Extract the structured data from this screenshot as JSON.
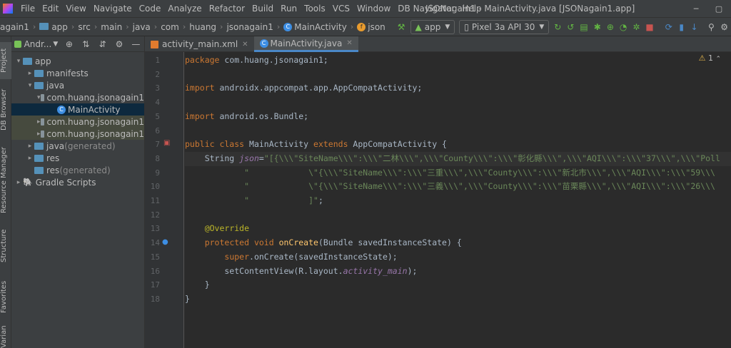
{
  "menubar": {
    "items": [
      "File",
      "Edit",
      "View",
      "Navigate",
      "Code",
      "Analyze",
      "Refactor",
      "Build",
      "Run",
      "Tools",
      "VCS",
      "Window",
      "DB Navigator",
      "Help"
    ],
    "title": "JSONagain1 - MainActivity.java [JSONagain1.app]",
    "minimize": "─",
    "restore": "▢"
  },
  "navbar": {
    "breadcrumbs": [
      "again1",
      "app",
      "src",
      "main",
      "java",
      "com",
      "huang",
      "jsonagain1",
      "MainActivity",
      "json"
    ],
    "run_config": "app",
    "device": "Pixel 3a API 30"
  },
  "leftstrip": {
    "tabs": [
      "Project",
      "DB Browser",
      "Resource Manager",
      "Structure",
      "Favorites",
      "Variants"
    ]
  },
  "project": {
    "view_name": "Andr...",
    "tree": [
      {
        "label": "app",
        "arrow": "▾",
        "indent": 0,
        "kind": "blue"
      },
      {
        "label": "manifests",
        "arrow": "▸",
        "indent": 1,
        "kind": "blue"
      },
      {
        "label": "java",
        "arrow": "▾",
        "indent": 1,
        "kind": "blue"
      },
      {
        "label": "com.huang.jsonagain1",
        "arrow": "▾",
        "indent": 2,
        "kind": "pkg"
      },
      {
        "label": "MainActivity",
        "arrow": "",
        "indent": 3,
        "kind": "class",
        "selected": true
      },
      {
        "label": "com.huang.jsonagain1",
        "arrow": "▸",
        "indent": 2,
        "kind": "pkg",
        "muted": true
      },
      {
        "label": "com.huang.jsonagain1",
        "arrow": "▸",
        "indent": 2,
        "kind": "pkg",
        "muted": true
      },
      {
        "label": "java",
        "suffix": " (generated)",
        "arrow": "▸",
        "indent": 1,
        "kind": "blue"
      },
      {
        "label": "res",
        "arrow": "▸",
        "indent": 1,
        "kind": "blue"
      },
      {
        "label": "res",
        "suffix": " (generated)",
        "arrow": "",
        "indent": 1,
        "kind": "blue"
      },
      {
        "label": "Gradle Scripts",
        "arrow": "▸",
        "indent": 0,
        "kind": "gradle"
      }
    ]
  },
  "editor": {
    "tabs": [
      {
        "label": "activity_main.xml",
        "active": false
      },
      {
        "label": "MainActivity.java",
        "active": true
      }
    ],
    "warning_count": "1",
    "lines": [
      {
        "n": "1",
        "html": "<span class=\"kw\">package </span>com.huang.jsonagain1;"
      },
      {
        "n": "2",
        "html": ""
      },
      {
        "n": "3",
        "html": "<span class=\"kw\">import </span>androidx.appcompat.app.AppCompatActivity;"
      },
      {
        "n": "4",
        "html": ""
      },
      {
        "n": "5",
        "html": "<span class=\"kw\">import </span>android.os.Bundle;"
      },
      {
        "n": "6",
        "html": ""
      },
      {
        "n": "7",
        "html": "<span class=\"kw\">public class </span>MainActivity <span class=\"kw\">extends </span>AppCompatActivity {"
      },
      {
        "n": "8",
        "html": "    String <span class=\"it\">json</span>=<span class=\"str\">\"[{\\\\\\\"SiteName\\\\\\\":\\\\\\\"二林\\\\\\\",\\\\\\\"County\\\\\\\":\\\\\\\"彰化縣\\\\\\\",\\\\\\\"AQI\\\\\\\":\\\\\\\"37\\\\\\\",\\\\\\\"Poll</span>",
        "cur": true
      },
      {
        "n": "9",
        "html": "<span class=\"str\">            \"            \\\"{\\\\\\\"SiteName\\\\\\\":\\\\\\\"三重\\\\\\\",\\\\\\\"County\\\\\\\":\\\\\\\"新北市\\\\\\\",\\\\\\\"AQI\\\\\\\":\\\\\\\"59\\\\\\</span>"
      },
      {
        "n": "10",
        "html": "<span class=\"str\">            \"            \\\"{\\\\\\\"SiteName\\\\\\\":\\\\\\\"三義\\\\\\\",\\\\\\\"County\\\\\\\":\\\\\\\"苗栗縣\\\\\\\",\\\\\\\"AQI\\\\\\\":\\\\\\\"26\\\\\\</span>"
      },
      {
        "n": "11",
        "html": "<span class=\"str\">            \"            ]\"</span>;"
      },
      {
        "n": "12",
        "html": ""
      },
      {
        "n": "13",
        "html": "    <span class=\"ann\">@Override</span>"
      },
      {
        "n": "14",
        "html": "    <span class=\"kw\">protected void </span><span class=\"fn\">onCreate</span>(Bundle savedInstanceState) {"
      },
      {
        "n": "15",
        "html": "        <span class=\"kw\">super</span>.onCreate(savedInstanceState);"
      },
      {
        "n": "16",
        "html": "        setContentView(R.layout.<span class=\"it\">activity_main</span>);"
      },
      {
        "n": "17",
        "html": "    }"
      },
      {
        "n": "18",
        "html": "}"
      }
    ]
  }
}
